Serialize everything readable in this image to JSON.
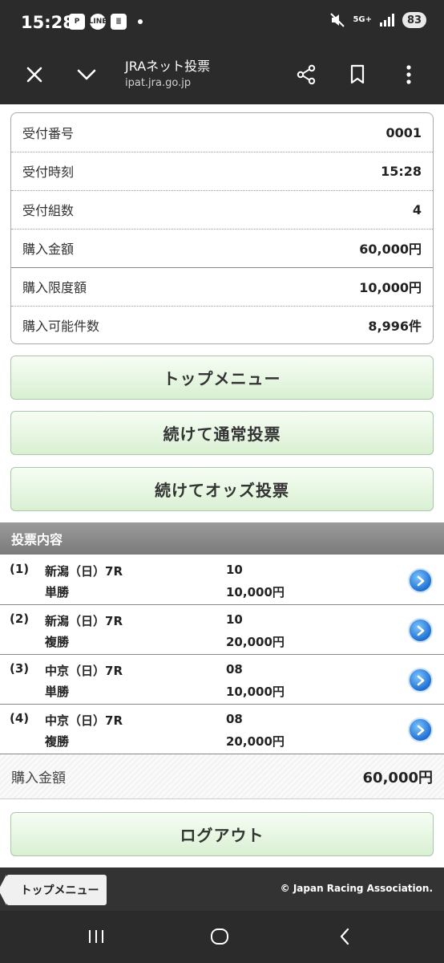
{
  "status_bar": {
    "time": "15:28",
    "app_icons": [
      "P",
      "LINE",
      "≣"
    ],
    "network": "5G+",
    "battery": "83"
  },
  "browser": {
    "title": "JRAネット投票",
    "url": "ipat.jra.go.jp",
    "icons": [
      "close-icon",
      "chevron-down-icon",
      "share-icon",
      "bookmark-icon",
      "more-vert-icon"
    ]
  },
  "receipt": {
    "rows": [
      {
        "label": "受付番号",
        "value": "0001"
      },
      {
        "label": "受付時刻",
        "value": "15:28"
      },
      {
        "label": "受付組数",
        "value": "4"
      },
      {
        "label": "購入金額",
        "value": "60,000円"
      },
      {
        "label": "購入限度額",
        "value": "10,000円"
      },
      {
        "label": "購入可能件数",
        "value": "8,996件"
      }
    ]
  },
  "buttons": {
    "top_menu": "トップメニュー",
    "continue_normal": "続けて通常投票",
    "continue_odds": "続けてオッズ投票",
    "logout": "ログアウト"
  },
  "bets": {
    "header": "投票内容",
    "items": [
      {
        "no": "(1)",
        "race": "新潟（日）7R",
        "type": "単勝",
        "horse": "10",
        "amount": "10,000円"
      },
      {
        "no": "(2)",
        "race": "新潟（日）7R",
        "type": "複勝",
        "horse": "10",
        "amount": "20,000円"
      },
      {
        "no": "(3)",
        "race": "中京（日）7R",
        "type": "単勝",
        "horse": "08",
        "amount": "10,000円"
      },
      {
        "no": "(4)",
        "race": "中京（日）7R",
        "type": "複勝",
        "horse": "08",
        "amount": "20,000円"
      }
    ]
  },
  "total": {
    "label": "購入金額",
    "value": "60,000円"
  },
  "footer": {
    "back_label": "トップメニュー",
    "copyright": "© Japan Racing Association."
  },
  "colors": {
    "bar_dark": "#2b2b2b",
    "button_green": "#d9f0d2",
    "header_gray": "#8a8a8a",
    "arrow_blue": "#1f6fd1"
  }
}
